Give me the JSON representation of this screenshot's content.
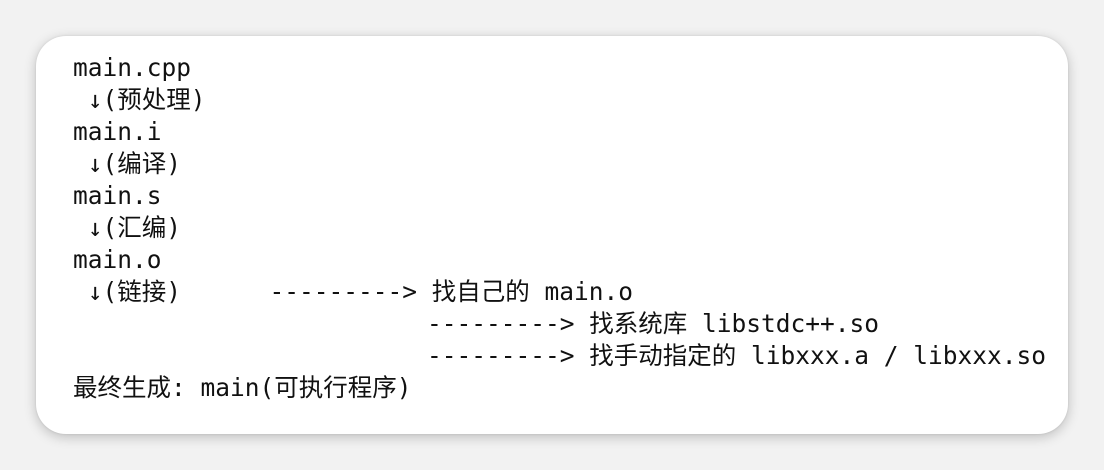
{
  "code_block": {
    "lines": [
      "main.cpp",
      " ↓(预处理)",
      "main.i",
      " ↓(编译)",
      "main.s",
      " ↓(汇编)",
      "main.o",
      " ↓(链接)      ---------> 找自己的 main.o",
      "                        ---------> 找系统库 libstdc++.so",
      "                        ---------> 找手动指定的 libxxx.a / libxxx.so",
      "最终生成: main(可执行程序)"
    ]
  }
}
